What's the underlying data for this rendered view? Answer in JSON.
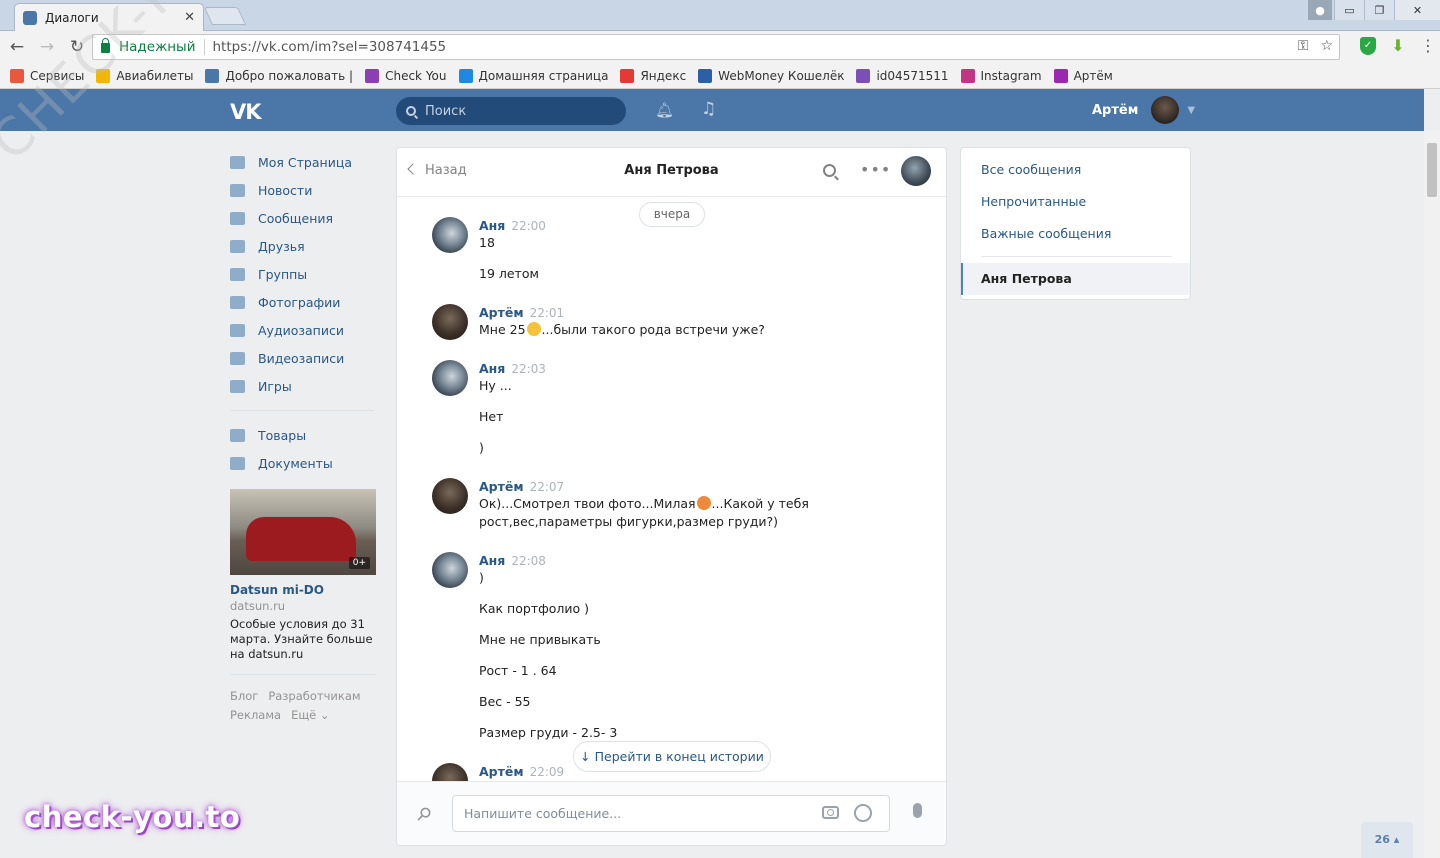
{
  "browser": {
    "tab_title": "Диалоги",
    "tab_close": "✕",
    "secure_label": "Надежный",
    "url": "https://vk.com/im?sel=308741455",
    "window_controls": {
      "minimize": "▭",
      "maximize": "❐",
      "close": "✕"
    },
    "bookmarks": [
      {
        "label": "Сервисы",
        "color": "#e8583c"
      },
      {
        "label": "Авиабилеты",
        "color": "#f2b705"
      },
      {
        "label": "Добро пожаловать |",
        "color": "#4a76a8"
      },
      {
        "label": "Check You",
        "color": "#8a3fb2"
      },
      {
        "label": "Домашняя страница",
        "color": "#1e88e5"
      },
      {
        "label": "Яндекс",
        "color": "#e53935"
      },
      {
        "label": "WebMoney Кошелёк",
        "color": "#2b5fa8"
      },
      {
        "label": "id04571511",
        "color": "#7b4fb8"
      },
      {
        "label": "Instagram",
        "color": "#c13584"
      },
      {
        "label": "Артём",
        "color": "#9c27b0"
      }
    ]
  },
  "vk_header": {
    "logo": "VK",
    "search_placeholder": "Поиск",
    "user_name": "Артём"
  },
  "sidebar": {
    "items": [
      {
        "label": "Моя Страница",
        "icon": "home-icon"
      },
      {
        "label": "Новости",
        "icon": "news-icon"
      },
      {
        "label": "Сообщения",
        "icon": "messages-icon"
      },
      {
        "label": "Друзья",
        "icon": "friends-icon"
      },
      {
        "label": "Группы",
        "icon": "groups-icon"
      },
      {
        "label": "Фотографии",
        "icon": "photos-icon"
      },
      {
        "label": "Аудиозаписи",
        "icon": "audio-icon"
      },
      {
        "label": "Видеозаписи",
        "icon": "video-icon"
      },
      {
        "label": "Игры",
        "icon": "games-icon"
      }
    ],
    "items2": [
      {
        "label": "Товары",
        "icon": "market-icon"
      },
      {
        "label": "Документы",
        "icon": "documents-icon"
      }
    ],
    "ad": {
      "badge": "0+",
      "title": "Datsun mi-DO",
      "domain": "datsun.ru",
      "text": "Особые условия до 31 марта. Узнайте больше на datsun.ru"
    },
    "footer": {
      "blog": "Блог",
      "devs": "Разработчикам",
      "ads": "Реклама",
      "more": "Ещё ⌄"
    }
  },
  "chat": {
    "back_label": "Назад",
    "title": "Аня Петрова",
    "date_divider": "вчера",
    "messages": [
      {
        "author": "Аня",
        "time": "22:00",
        "lines": [
          "18",
          "19 летом"
        ]
      },
      {
        "author": "Артём",
        "time": "22:01",
        "lines": [
          "Мне 25",
          "...были такого рода встречи уже?"
        ]
      },
      {
        "author": "Аня",
        "time": "22:03",
        "lines": [
          "Ну ...",
          "Нет",
          ")"
        ]
      },
      {
        "author": "Артём",
        "time": "22:07",
        "lines": [
          "Ок)...Смотрел твои фото...Милая",
          "...Какой у тебя",
          "рост,вес,параметры фигурки,размер груди?)"
        ]
      },
      {
        "author": "Аня",
        "time": "22:08",
        "lines": [
          ")",
          "Как портфолио )",
          "Мне не привыкать",
          "Рост - 1 . 64",
          "Вес - 55",
          "Размер груди - 2.5- 3"
        ]
      },
      {
        "author": "Артём",
        "time": "22:09",
        "lines": []
      }
    ],
    "goto_end": "↓  Перейти в конец истории",
    "composer_placeholder": "Напишите сообщение..."
  },
  "filters": {
    "all": "Все сообщения",
    "unread": "Непрочитанные",
    "important": "Важные сообщения",
    "active_dialog": "Аня Петрова"
  },
  "counter": "26 ▴",
  "watermark": {
    "logo": "check-you.to",
    "diagonal": "CHECK-YOU.ME"
  }
}
